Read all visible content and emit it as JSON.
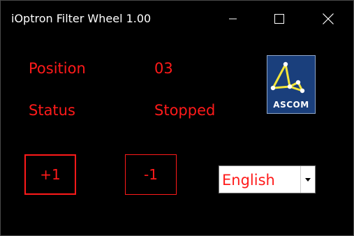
{
  "window": {
    "title": "iOptron Filter Wheel 1.00",
    "controls": [
      "minimize-icon",
      "maximize-icon",
      "close-icon"
    ]
  },
  "fields": {
    "position_label": "Position",
    "position_value": "03",
    "status_label": "Status",
    "status_value": "Stopped"
  },
  "logo": {
    "text": "ASCOM"
  },
  "buttons": {
    "increment_label": "+1",
    "decrement_label": "-1"
  },
  "language": {
    "selected": "English",
    "arrow_icon": "chevron-down-icon"
  },
  "colors": {
    "background": "#000000",
    "accent": "#ff1a1a",
    "title_text": "#ffffff",
    "logo_bg": "#1a3f7c"
  }
}
